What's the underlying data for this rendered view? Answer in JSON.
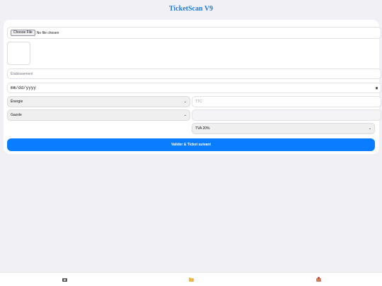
{
  "app": {
    "title": "TicketScan V9"
  },
  "form": {
    "file": {
      "button_label": "Choose File",
      "status": "No file chosen"
    },
    "establishment": {
      "placeholder": "Établissement"
    },
    "date": {
      "placeholder": "mm/dd/yyyy"
    },
    "category": {
      "selected": "Énergie"
    },
    "amount_ttc": {
      "placeholder": "TTC"
    },
    "subcategory": {
      "selected": "Gazole"
    },
    "vat": {
      "selected": "TVA 20%"
    },
    "submit_label": "Valider & Ticket suivant"
  },
  "bottom_nav": [
    {
      "icon": "camera-icon"
    },
    {
      "icon": "folder-icon"
    },
    {
      "icon": "export-icon"
    }
  ],
  "colors": {
    "accent": "#0a7cff",
    "title": "#1e7bd6",
    "background": "#f1f1f5"
  }
}
